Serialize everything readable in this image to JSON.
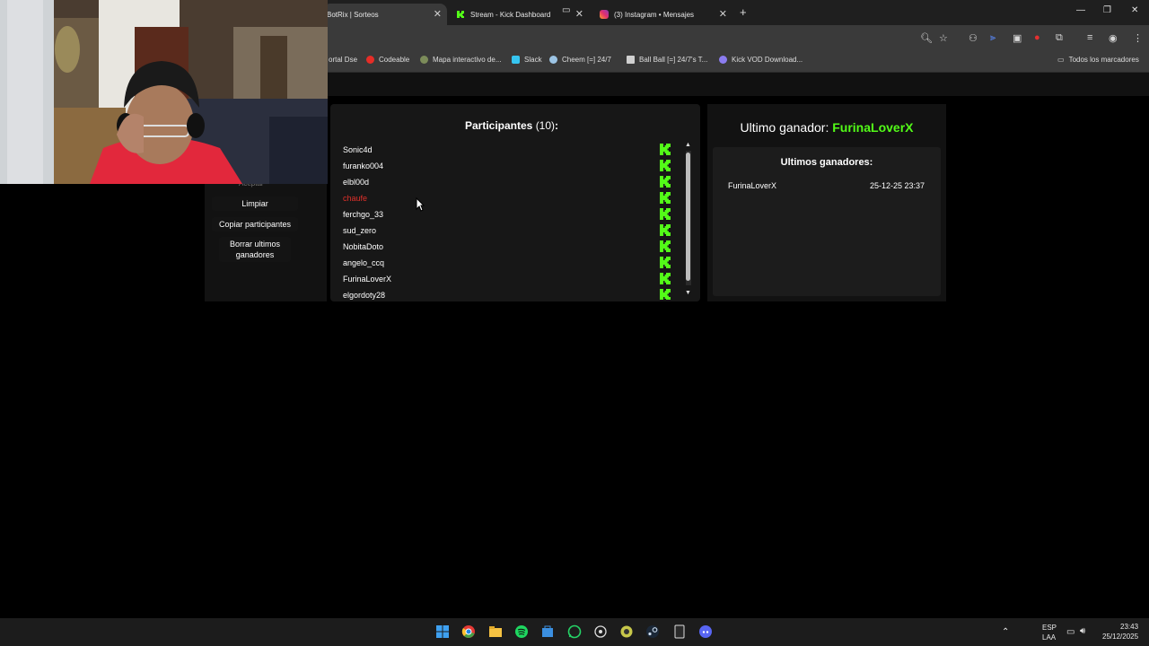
{
  "browser": {
    "tabs": [
      {
        "label": "BotRix | Sorteos",
        "active": true
      },
      {
        "label": "Stream - Kick Dashboard",
        "active": false
      },
      {
        "label": "(3) Instagram • Mensajes",
        "active": false
      }
    ],
    "new_tab": "+",
    "bookmarks": [
      "ortal Dse",
      "Codeable",
      "Mapa interactivo de...",
      "Slack",
      "Cheem [=] 24/7",
      "Ball Ball [=] 24/7's T...",
      "Kick VOD Download..."
    ],
    "all_bookmarks": "Todos los marcadores"
  },
  "sidebar": {
    "hidden_label": "Aceptar",
    "clear_label": "Limpiar",
    "copy_label": "Copiar participantes",
    "delete_label": "Borrar ultimos ganadores"
  },
  "participants": {
    "title": "Participantes",
    "count": "(10)",
    "colon": ":",
    "items": [
      {
        "name": "Sonic4d",
        "excluded": false
      },
      {
        "name": "furanko004",
        "excluded": false
      },
      {
        "name": "elbl00d",
        "excluded": false
      },
      {
        "name": "chaufe",
        "excluded": true
      },
      {
        "name": "ferchgo_33",
        "excluded": false
      },
      {
        "name": "sud_zero",
        "excluded": false
      },
      {
        "name": "NobitaDoto",
        "excluded": false
      },
      {
        "name": "angelo_ccq",
        "excluded": false
      },
      {
        "name": "FurinaLoverX",
        "excluded": false
      },
      {
        "name": "elgordoty28",
        "excluded": false
      }
    ]
  },
  "winner": {
    "label": "Ultimo ganador:",
    "name": "FurinaLoverX",
    "history_title": "Ultimos ganadores:",
    "history": [
      {
        "name": "FurinaLoverX",
        "date": "25-12-25 23:37"
      }
    ]
  },
  "taskbar": {
    "lang1": "ESP",
    "lang2": "LAA",
    "time": "23:43",
    "date": "25/12/2025"
  },
  "colors": {
    "kick_green": "#53fc18",
    "excluded_red": "#e0302a"
  }
}
